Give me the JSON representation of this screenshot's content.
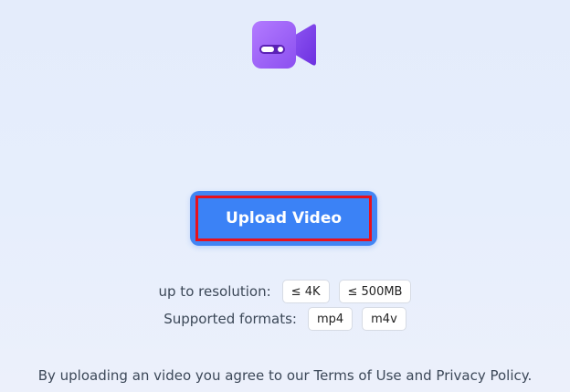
{
  "logo": {
    "icon": "video-camera-icon",
    "colors": {
      "body": "#9b5cf6",
      "lens": "#7c3aed"
    }
  },
  "upload": {
    "button_label": "Upload Video",
    "accent_color": "#3b82f6",
    "highlight_color": "#e8101c"
  },
  "resolution": {
    "label": "up to resolution:",
    "chips": [
      "≤ 4K",
      "≤ 500MB"
    ]
  },
  "formats": {
    "label": "Supported formats:",
    "chips": [
      "mp4",
      "m4v"
    ]
  },
  "footer": {
    "terms_text": "By uploading an video you agree to our Terms of Use and Privacy Policy."
  }
}
